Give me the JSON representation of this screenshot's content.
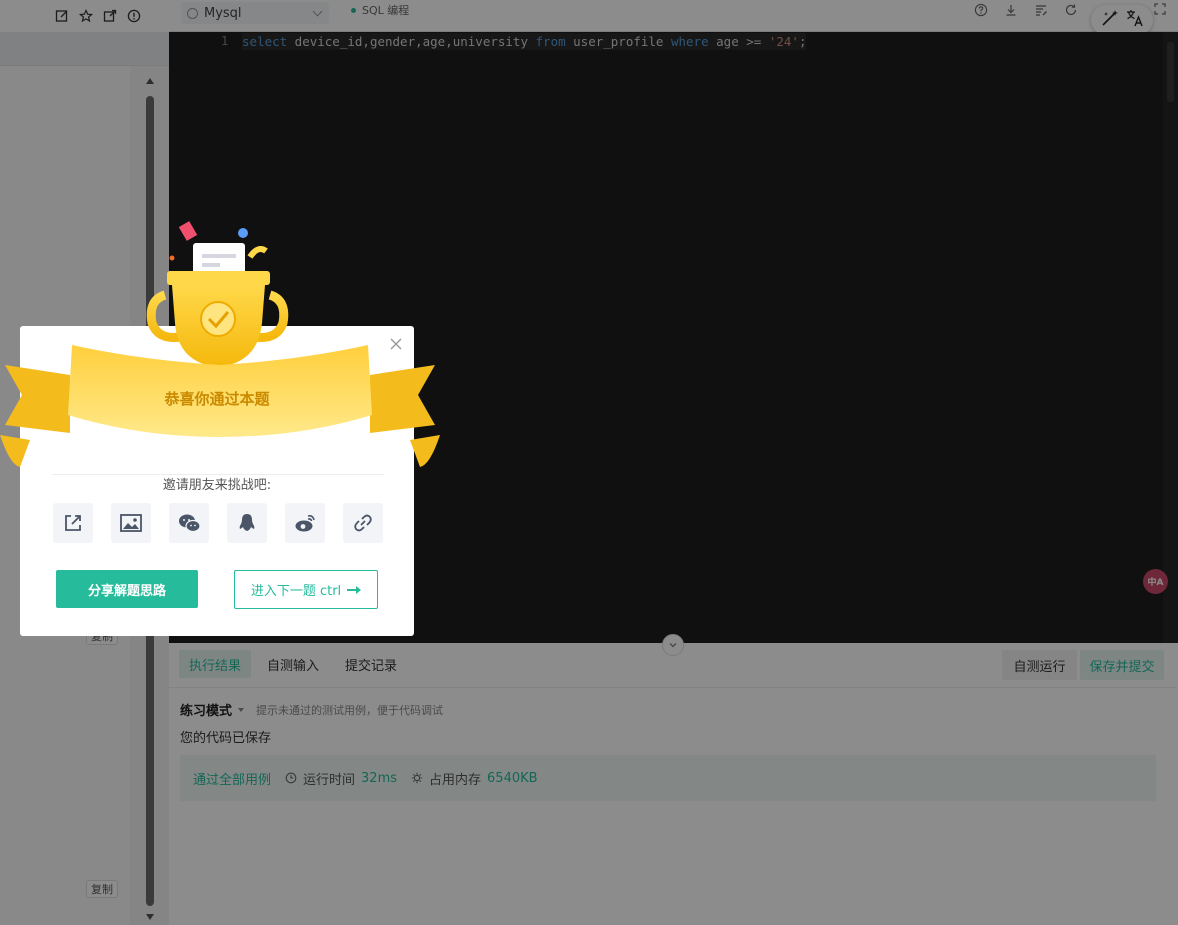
{
  "editor": {
    "language": "Mysql",
    "mode_label": "SQL 编程",
    "line_number": "1",
    "code_tokens": [
      {
        "text": "select",
        "kind": "kw"
      },
      {
        "text": " device_id,gender,age,university ",
        "kind": "id"
      },
      {
        "text": "from",
        "kind": "kw"
      },
      {
        "text": " user_profile ",
        "kind": "id"
      },
      {
        "text": "where",
        "kind": "kw"
      },
      {
        "text": " age >= ",
        "kind": "id"
      },
      {
        "text": "'24'",
        "kind": "str"
      },
      {
        "text": ";",
        "kind": "id"
      }
    ]
  },
  "left_panel": {
    "copy_label": "复制"
  },
  "results": {
    "tabs": [
      {
        "label": "执行结果",
        "active": true
      },
      {
        "label": "自测输入",
        "active": false
      },
      {
        "label": "提交记录",
        "active": false
      }
    ],
    "run_label": "自测运行",
    "submit_label": "保存并提交",
    "practice_title": "练习模式",
    "practice_hint": "提示未通过的测试用例，便于代码调试",
    "saved_message": "您的代码已保存",
    "pass_label": "通过全部用例",
    "runtime_label": "运行时间",
    "runtime_value": "32ms",
    "memory_label": "占用内存",
    "memory_value": "6540KB"
  },
  "modal": {
    "title": "恭喜你通过本题",
    "invite_text": "邀请朋友来挑战吧:",
    "share_icons": [
      "share-out-icon",
      "image-icon",
      "wechat-icon",
      "qq-icon",
      "weibo-icon",
      "link-icon"
    ],
    "share_button": "分享解题思路",
    "next_button": "进入下一题 ctrl"
  },
  "floating": {
    "translate_badge": "中A"
  },
  "colors": {
    "accent": "#25bb9b",
    "editor_bg": "#1e1e1e",
    "gold": "#f5b80c"
  }
}
